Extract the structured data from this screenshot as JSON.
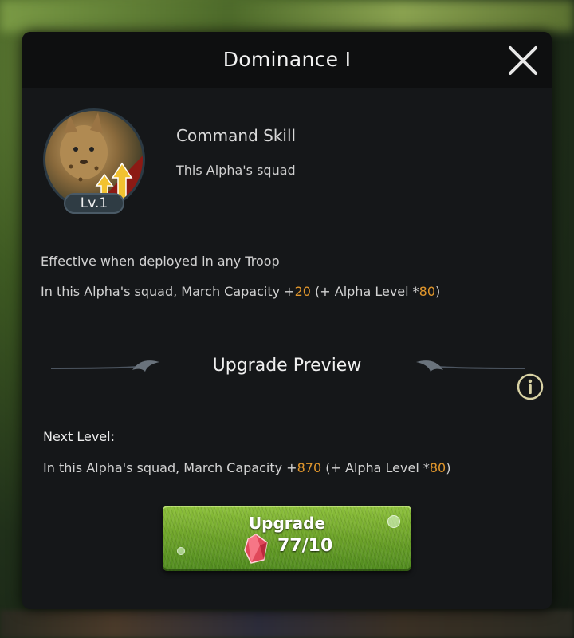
{
  "dialog": {
    "title": "Dominance I"
  },
  "skill": {
    "level_badge": "Lv.1",
    "name": "Command Skill",
    "target": "This Alpha's squad",
    "effective_note": "Effective when deployed in any Troop",
    "current_effect": {
      "prefix": "In this Alpha's squad, March Capacity +",
      "base_value": "20",
      "middle": " (+ Alpha Level *",
      "multiplier": "80",
      "suffix": ")"
    }
  },
  "upgrade_preview": {
    "title": "Upgrade Preview",
    "next_level_label": "Next Level:",
    "next_effect": {
      "prefix": "In this Alpha's squad, March Capacity +",
      "base_value": "870",
      "middle": " (+ Alpha Level *",
      "multiplier": "80",
      "suffix": ")"
    }
  },
  "upgrade_button": {
    "label": "Upgrade",
    "cost": "77/10",
    "cost_icon": "red-gem-icon"
  },
  "colors": {
    "highlight": "#e0962c",
    "panel": "#151719",
    "button_green": "#6fa52a"
  },
  "icons": [
    "close-icon",
    "info-icon",
    "skill-portrait-serval",
    "arrow-up-icon",
    "red-gem-icon"
  ]
}
